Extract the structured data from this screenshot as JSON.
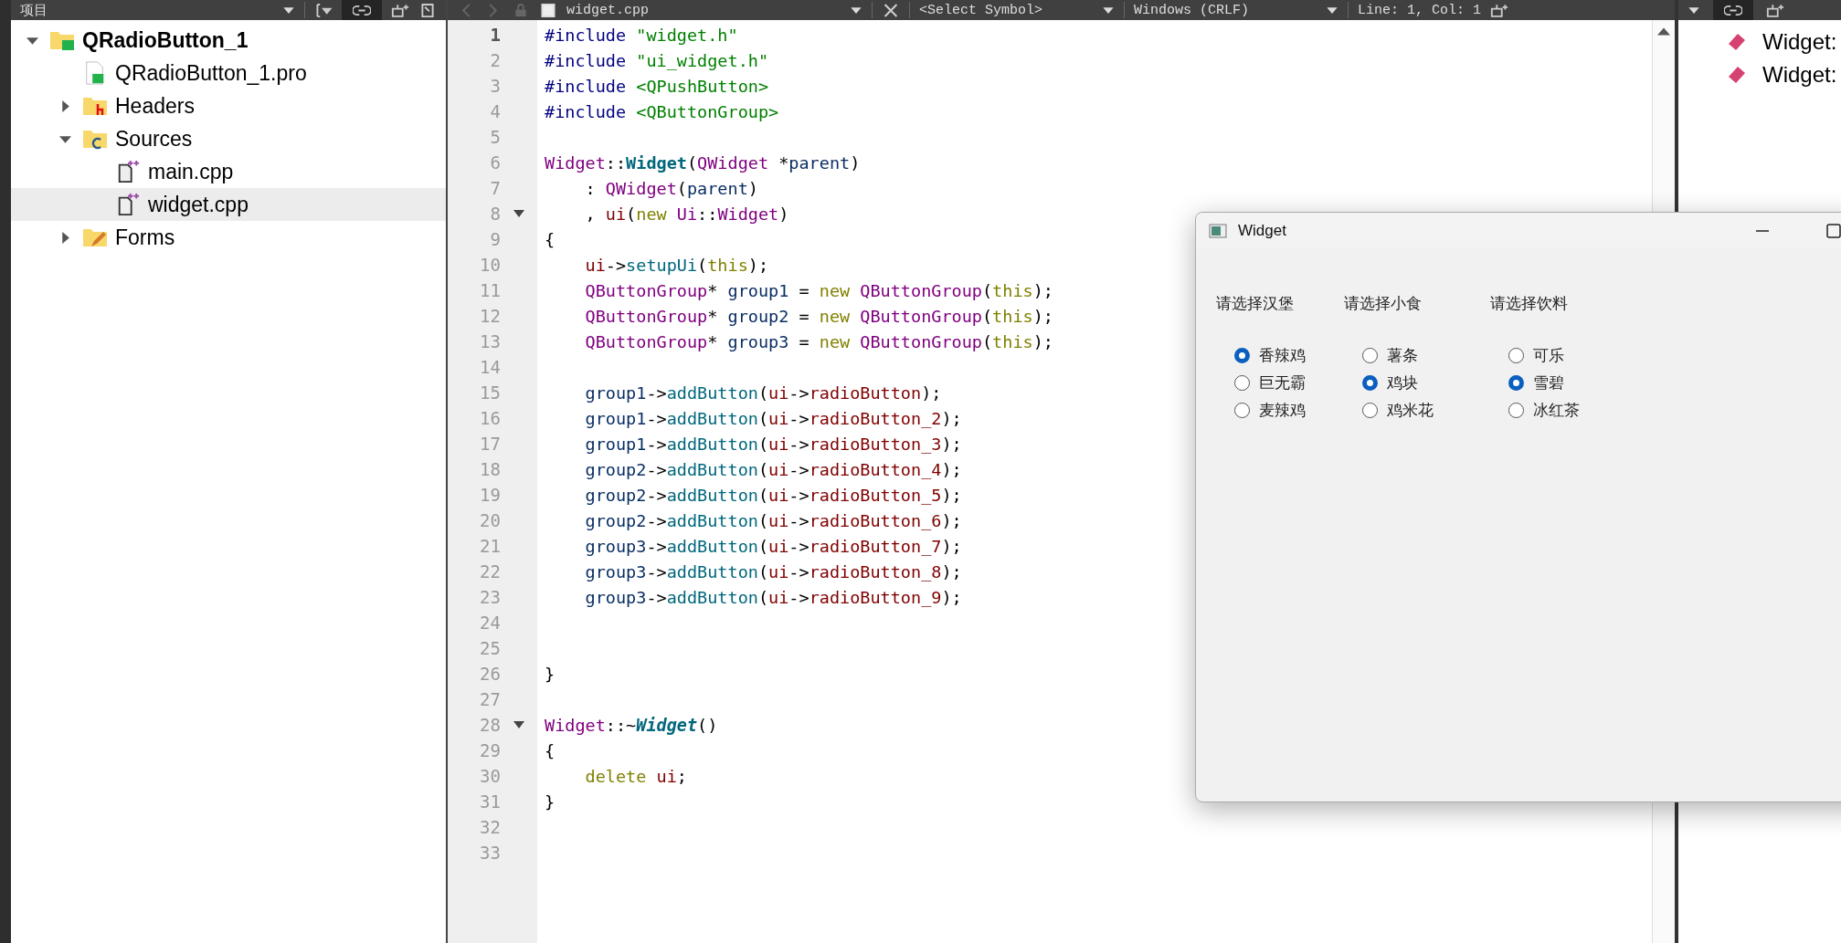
{
  "sidebar": {
    "title": "项目",
    "tree": [
      {
        "label": "QRadioButton_1",
        "kind": "project",
        "expanded": true,
        "selected": false,
        "children": [
          {
            "label": "QRadioButton_1.pro",
            "kind": "pro",
            "selected": false
          },
          {
            "label": "Headers",
            "kind": "headers",
            "expanded": false,
            "selected": false
          },
          {
            "label": "Sources",
            "kind": "sources",
            "expanded": true,
            "selected": false,
            "children": [
              {
                "label": "main.cpp",
                "kind": "cpp",
                "selected": false
              },
              {
                "label": "widget.cpp",
                "kind": "cpp",
                "selected": true
              }
            ]
          },
          {
            "label": "Forms",
            "kind": "forms",
            "expanded": false,
            "selected": false
          }
        ]
      }
    ]
  },
  "editor_toolbar": {
    "file": "widget.cpp",
    "symbol": "<Select Symbol>",
    "line_endings": "Windows (CRLF)",
    "position": "Line: 1, Col: 1"
  },
  "editor": {
    "lines": [
      {
        "n": "1",
        "current": true,
        "fold": false,
        "tokens": [
          {
            "kind": "pp",
            "text": "#include"
          },
          {
            "kind": "str",
            "text": " \"widget.h\""
          }
        ]
      },
      {
        "n": "2",
        "current": false,
        "fold": false,
        "tokens": [
          {
            "kind": "pp",
            "text": "#include"
          },
          {
            "kind": "str",
            "text": " \"ui_widget.h\""
          }
        ]
      },
      {
        "n": "3",
        "current": false,
        "fold": false,
        "tokens": [
          {
            "kind": "pp",
            "text": "#include"
          },
          {
            "kind": "str",
            "text": " <QPushButton>"
          }
        ]
      },
      {
        "n": "4",
        "current": false,
        "fold": false,
        "tokens": [
          {
            "kind": "pp",
            "text": "#include"
          },
          {
            "kind": "str",
            "text": " <QButtonGroup>"
          }
        ]
      },
      {
        "n": "5",
        "current": false,
        "fold": false
      },
      {
        "n": "6",
        "current": false,
        "fold": false,
        "tokens": [
          {
            "kind": "type",
            "text": "Widget"
          },
          {
            "kind": "plain",
            "text": "::"
          },
          {
            "kind": "decl",
            "text": "Widget"
          },
          {
            "kind": "plain",
            "text": "("
          },
          {
            "kind": "type",
            "text": "QWidget"
          },
          {
            "kind": "plain",
            "text": " *"
          },
          {
            "kind": "local",
            "text": "parent"
          },
          {
            "kind": "plain",
            "text": ")"
          }
        ]
      },
      {
        "n": "7",
        "current": false,
        "fold": false,
        "tokens": [
          {
            "kind": "plain",
            "text": "    : "
          },
          {
            "kind": "type",
            "text": "QWidget"
          },
          {
            "kind": "plain",
            "text": "("
          },
          {
            "kind": "local",
            "text": "parent"
          },
          {
            "kind": "plain",
            "text": ")"
          }
        ]
      },
      {
        "n": "8",
        "current": false,
        "fold": true,
        "tokens": [
          {
            "kind": "plain",
            "text": "    , "
          },
          {
            "kind": "field",
            "text": "ui"
          },
          {
            "kind": "plain",
            "text": "("
          },
          {
            "kind": "kw",
            "text": "new"
          },
          {
            "kind": "type",
            "text": " Ui"
          },
          {
            "kind": "plain",
            "text": "::"
          },
          {
            "kind": "type",
            "text": "Widget"
          },
          {
            "kind": "plain",
            "text": ")"
          }
        ]
      },
      {
        "n": "9",
        "current": false,
        "fold": false,
        "tokens": [
          {
            "kind": "plain",
            "text": "{"
          }
        ]
      },
      {
        "n": "10",
        "current": false,
        "fold": false,
        "tokens": [
          {
            "kind": "field",
            "text": "    ui"
          },
          {
            "kind": "plain",
            "text": "->"
          },
          {
            "kind": "fn",
            "text": "setupUi"
          },
          {
            "kind": "plain",
            "text": "("
          },
          {
            "kind": "kw",
            "text": "this"
          },
          {
            "kind": "plain",
            "text": ");"
          }
        ]
      },
      {
        "n": "11",
        "current": false,
        "fold": false,
        "tokens": [
          {
            "kind": "type",
            "text": "    QButtonGroup"
          },
          {
            "kind": "plain",
            "text": "* "
          },
          {
            "kind": "local",
            "text": "group1"
          },
          {
            "kind": "plain",
            "text": " = "
          },
          {
            "kind": "kw",
            "text": "new"
          },
          {
            "kind": "type",
            "text": " QButtonGroup"
          },
          {
            "kind": "plain",
            "text": "("
          },
          {
            "kind": "kw",
            "text": "this"
          },
          {
            "kind": "plain",
            "text": ");"
          }
        ]
      },
      {
        "n": "12",
        "current": false,
        "fold": false,
        "tokens": [
          {
            "kind": "type",
            "text": "    QButtonGroup"
          },
          {
            "kind": "plain",
            "text": "* "
          },
          {
            "kind": "local",
            "text": "group2"
          },
          {
            "kind": "plain",
            "text": " = "
          },
          {
            "kind": "kw",
            "text": "new"
          },
          {
            "kind": "type",
            "text": " QButtonGroup"
          },
          {
            "kind": "plain",
            "text": "("
          },
          {
            "kind": "kw",
            "text": "this"
          },
          {
            "kind": "plain",
            "text": ");"
          }
        ]
      },
      {
        "n": "13",
        "current": false,
        "fold": false,
        "tokens": [
          {
            "kind": "type",
            "text": "    QButtonGroup"
          },
          {
            "kind": "plain",
            "text": "* "
          },
          {
            "kind": "local",
            "text": "group3"
          },
          {
            "kind": "plain",
            "text": " = "
          },
          {
            "kind": "kw",
            "text": "new"
          },
          {
            "kind": "type",
            "text": " QButtonGroup"
          },
          {
            "kind": "plain",
            "text": "("
          },
          {
            "kind": "kw",
            "text": "this"
          },
          {
            "kind": "plain",
            "text": ");"
          }
        ]
      },
      {
        "n": "14",
        "current": false,
        "fold": false
      },
      {
        "n": "15",
        "current": false,
        "fold": false,
        "tokens": [
          {
            "kind": "local",
            "text": "    group1"
          },
          {
            "kind": "plain",
            "text": "->"
          },
          {
            "kind": "fn",
            "text": "addButton"
          },
          {
            "kind": "plain",
            "text": "("
          },
          {
            "kind": "field",
            "text": "ui"
          },
          {
            "kind": "plain",
            "text": "->"
          },
          {
            "kind": "field",
            "text": "radioButton"
          },
          {
            "kind": "plain",
            "text": ");"
          }
        ]
      },
      {
        "n": "16",
        "current": false,
        "fold": false,
        "tokens": [
          {
            "kind": "local",
            "text": "    group1"
          },
          {
            "kind": "plain",
            "text": "->"
          },
          {
            "kind": "fn",
            "text": "addButton"
          },
          {
            "kind": "plain",
            "text": "("
          },
          {
            "kind": "field",
            "text": "ui"
          },
          {
            "kind": "plain",
            "text": "->"
          },
          {
            "kind": "field",
            "text": "radioButton_2"
          },
          {
            "kind": "plain",
            "text": ");"
          }
        ]
      },
      {
        "n": "17",
        "current": false,
        "fold": false,
        "tokens": [
          {
            "kind": "local",
            "text": "    group1"
          },
          {
            "kind": "plain",
            "text": "->"
          },
          {
            "kind": "fn",
            "text": "addButton"
          },
          {
            "kind": "plain",
            "text": "("
          },
          {
            "kind": "field",
            "text": "ui"
          },
          {
            "kind": "plain",
            "text": "->"
          },
          {
            "kind": "field",
            "text": "radioButton_3"
          },
          {
            "kind": "plain",
            "text": ");"
          }
        ]
      },
      {
        "n": "18",
        "current": false,
        "fold": false,
        "tokens": [
          {
            "kind": "local",
            "text": "    group2"
          },
          {
            "kind": "plain",
            "text": "->"
          },
          {
            "kind": "fn",
            "text": "addButton"
          },
          {
            "kind": "plain",
            "text": "("
          },
          {
            "kind": "field",
            "text": "ui"
          },
          {
            "kind": "plain",
            "text": "->"
          },
          {
            "kind": "field",
            "text": "radioButton_4"
          },
          {
            "kind": "plain",
            "text": ");"
          }
        ]
      },
      {
        "n": "19",
        "current": false,
        "fold": false,
        "tokens": [
          {
            "kind": "local",
            "text": "    group2"
          },
          {
            "kind": "plain",
            "text": "->"
          },
          {
            "kind": "fn",
            "text": "addButton"
          },
          {
            "kind": "plain",
            "text": "("
          },
          {
            "kind": "field",
            "text": "ui"
          },
          {
            "kind": "plain",
            "text": "->"
          },
          {
            "kind": "field",
            "text": "radioButton_5"
          },
          {
            "kind": "plain",
            "text": ");"
          }
        ]
      },
      {
        "n": "20",
        "current": false,
        "fold": false,
        "tokens": [
          {
            "kind": "local",
            "text": "    group2"
          },
          {
            "kind": "plain",
            "text": "->"
          },
          {
            "kind": "fn",
            "text": "addButton"
          },
          {
            "kind": "plain",
            "text": "("
          },
          {
            "kind": "field",
            "text": "ui"
          },
          {
            "kind": "plain",
            "text": "->"
          },
          {
            "kind": "field",
            "text": "radioButton_6"
          },
          {
            "kind": "plain",
            "text": ");"
          }
        ]
      },
      {
        "n": "21",
        "current": false,
        "fold": false,
        "tokens": [
          {
            "kind": "local",
            "text": "    group3"
          },
          {
            "kind": "plain",
            "text": "->"
          },
          {
            "kind": "fn",
            "text": "addButton"
          },
          {
            "kind": "plain",
            "text": "("
          },
          {
            "kind": "field",
            "text": "ui"
          },
          {
            "kind": "plain",
            "text": "->"
          },
          {
            "kind": "field",
            "text": "radioButton_7"
          },
          {
            "kind": "plain",
            "text": ");"
          }
        ]
      },
      {
        "n": "22",
        "current": false,
        "fold": false,
        "tokens": [
          {
            "kind": "local",
            "text": "    group3"
          },
          {
            "kind": "plain",
            "text": "->"
          },
          {
            "kind": "fn",
            "text": "addButton"
          },
          {
            "kind": "plain",
            "text": "("
          },
          {
            "kind": "field",
            "text": "ui"
          },
          {
            "kind": "plain",
            "text": "->"
          },
          {
            "kind": "field",
            "text": "radioButton_8"
          },
          {
            "kind": "plain",
            "text": ");"
          }
        ]
      },
      {
        "n": "23",
        "current": false,
        "fold": false,
        "tokens": [
          {
            "kind": "local",
            "text": "    group3"
          },
          {
            "kind": "plain",
            "text": "->"
          },
          {
            "kind": "fn",
            "text": "addButton"
          },
          {
            "kind": "plain",
            "text": "("
          },
          {
            "kind": "field",
            "text": "ui"
          },
          {
            "kind": "plain",
            "text": "->"
          },
          {
            "kind": "field",
            "text": "radioButton_9"
          },
          {
            "kind": "plain",
            "text": ");"
          }
        ]
      },
      {
        "n": "24",
        "current": false,
        "fold": false
      },
      {
        "n": "25",
        "current": false,
        "fold": false
      },
      {
        "n": "26",
        "current": false,
        "fold": false,
        "tokens": [
          {
            "kind": "plain",
            "text": "}"
          }
        ]
      },
      {
        "n": "27",
        "current": false,
        "fold": false
      },
      {
        "n": "28",
        "current": false,
        "fold": true,
        "tokens": [
          {
            "kind": "type",
            "text": "Widget"
          },
          {
            "kind": "plain",
            "text": "::~"
          },
          {
            "kind": "dtor",
            "text": "Widget"
          },
          {
            "kind": "plain",
            "text": "()"
          }
        ]
      },
      {
        "n": "29",
        "current": false,
        "fold": false,
        "tokens": [
          {
            "kind": "plain",
            "text": "{"
          }
        ]
      },
      {
        "n": "30",
        "current": false,
        "fold": false,
        "tokens": [
          {
            "kind": "kw",
            "text": "    delete"
          },
          {
            "kind": "field",
            "text": " ui"
          },
          {
            "kind": "plain",
            "text": ";"
          }
        ]
      },
      {
        "n": "31",
        "current": false,
        "fold": false,
        "tokens": [
          {
            "kind": "plain",
            "text": "}"
          }
        ]
      },
      {
        "n": "32",
        "current": false,
        "fold": false
      },
      {
        "n": "33",
        "current": false,
        "fold": false
      }
    ]
  },
  "outline": {
    "items": [
      {
        "text": "Widget:"
      },
      {
        "text": "Widget:"
      }
    ]
  },
  "widget_window": {
    "title": "Widget",
    "groups": [
      {
        "label": "请选择汉堡",
        "options": [
          {
            "text": "香辣鸡",
            "selected": true
          },
          {
            "text": "巨无霸",
            "selected": false
          },
          {
            "text": "麦辣鸡",
            "selected": false
          }
        ]
      },
      {
        "label": "请选择小食",
        "options": [
          {
            "text": "薯条",
            "selected": false
          },
          {
            "text": "鸡块",
            "selected": true
          },
          {
            "text": "鸡米花",
            "selected": false
          }
        ]
      },
      {
        "label": "请选择饮料",
        "options": [
          {
            "text": "可乐",
            "selected": false
          },
          {
            "text": "雪碧",
            "selected": true
          },
          {
            "text": "冰红茶",
            "selected": false
          }
        ]
      }
    ]
  }
}
